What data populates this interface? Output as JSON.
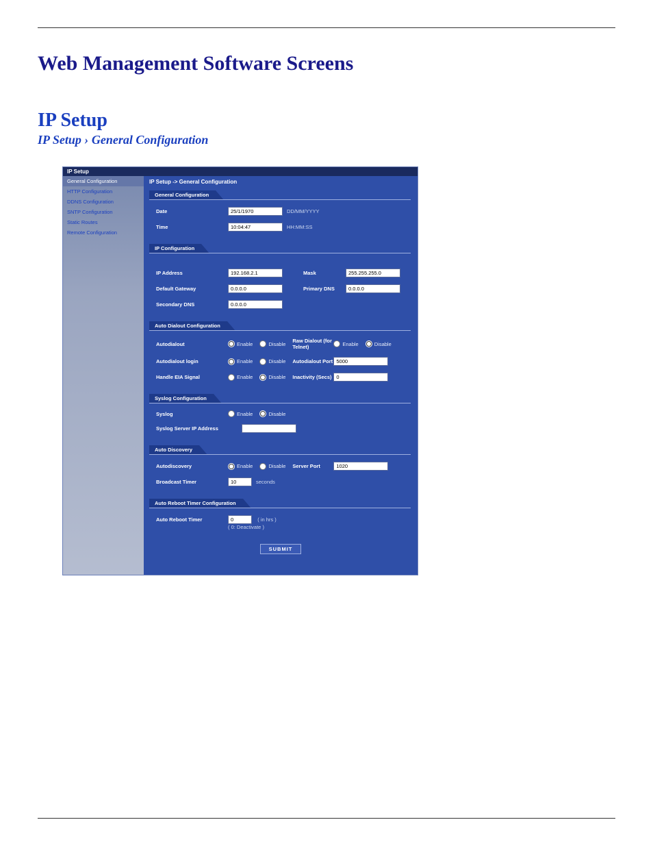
{
  "page": {
    "title": "Web Management Software Screens",
    "section": "IP Setup",
    "breadcrumb": "IP Setup › General Configuration"
  },
  "app": {
    "section_bar": "IP Setup",
    "crumb": "IP Setup -> General Configuration",
    "sidebar": [
      {
        "label": "General Configuration",
        "active": true
      },
      {
        "label": "HTTP Configuration",
        "active": false
      },
      {
        "label": "DDNS Configuration",
        "active": false
      },
      {
        "label": "SNTP Configuration",
        "active": false
      },
      {
        "label": "Static Routes",
        "active": false
      },
      {
        "label": "Remote Configuration",
        "active": false
      }
    ],
    "panels": {
      "general": {
        "header": "General Configuration",
        "date_label": "Date",
        "date_value": "25/1/1970",
        "date_hint": "DD/MM/YYYY",
        "time_label": "Time",
        "time_value": "10:04:47",
        "time_hint": "HH:MM:SS"
      },
      "ip": {
        "header": "IP Configuration",
        "ip_label": "IP Address",
        "ip_value": "192.168.2.1",
        "mask_label": "Mask",
        "mask_value": "255.255.255.0",
        "gw_label": "Default Gateway",
        "gw_value": "0.0.0.0",
        "pdns_label": "Primary DNS",
        "pdns_value": "0.0.0.0",
        "sdns_label": "Secondary DNS",
        "sdns_value": "0.0.0.0"
      },
      "autodial": {
        "header": "Auto Dialout Configuration",
        "ad_label": "Autodialout",
        "ad_value": "enable",
        "raw_label": "Raw Dialout (for Telnet)",
        "raw_value": "disable",
        "login_label": "Autodialout login",
        "login_value": "enable",
        "port_label": "Autodialout Port",
        "port_value": "5000",
        "eia_label": "Handle EIA Signal",
        "eia_value": "disable",
        "inact_label": "Inactivity (Secs)",
        "inact_value": "0",
        "opt_enable": "Enable",
        "opt_disable": "Disable"
      },
      "syslog": {
        "header": "Syslog Configuration",
        "sys_label": "Syslog",
        "sys_value": "disable",
        "server_label": "Syslog Server IP Address",
        "server_value": "",
        "opt_enable": "Enable",
        "opt_disable": "Disable"
      },
      "autodisc": {
        "header": "Auto Discovery",
        "ad_label": "Autodiscovery",
        "ad_value": "enable",
        "port_label": "Server Port",
        "port_value": "1020",
        "bt_label": "Broadcast Timer",
        "bt_value": "10",
        "bt_hint": "seconds",
        "opt_enable": "Enable",
        "opt_disable": "Disable"
      },
      "reboot": {
        "header": "Auto Reboot Timer Configuration",
        "label": "Auto Reboot Timer",
        "value": "0",
        "hint1": "( in hrs )",
        "hint2": "( 0: Deactivate )"
      }
    },
    "submit": "SUBMIT"
  }
}
